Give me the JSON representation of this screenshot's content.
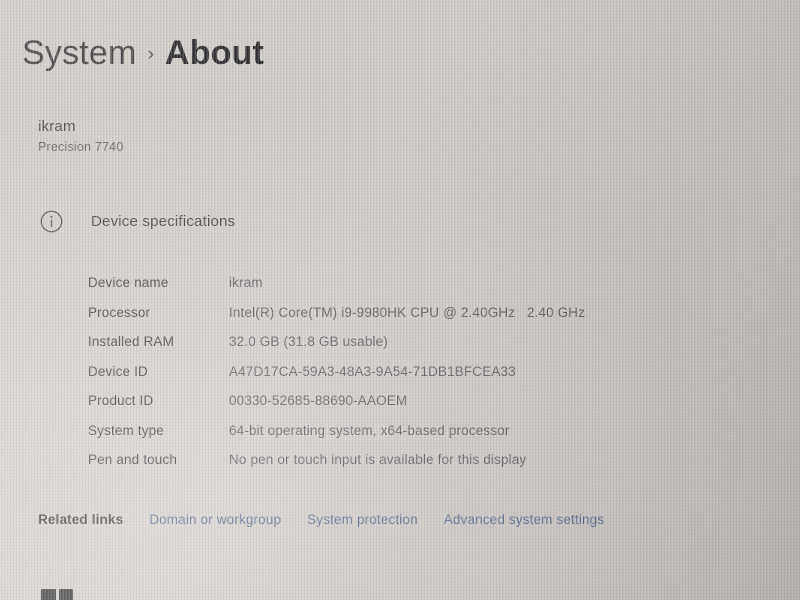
{
  "breadcrumb": {
    "root": "System",
    "separator": "›",
    "current": "About"
  },
  "device_heading": {
    "name": "ikram",
    "model": "Precision 7740"
  },
  "spec_section": {
    "icon": "info-icon",
    "title": "Device specifications",
    "rows": [
      {
        "label": "Device name",
        "value": "ikram"
      },
      {
        "label": "Processor",
        "value": "Intel(R) Core(TM) i9-9980HK CPU @ 2.40GHz   2.40 GHz"
      },
      {
        "label": "Installed RAM",
        "value": "32.0 GB (31.8 GB usable)"
      },
      {
        "label": "Device ID",
        "value": "A47D17CA-59A3-48A3-9A54-71DB1BFCEA33"
      },
      {
        "label": "Product ID",
        "value": "00330-52685-88690-AAOEM"
      },
      {
        "label": "System type",
        "value": "64-bit operating system, x64-based processor"
      },
      {
        "label": "Pen and touch",
        "value": "No pen or touch input is available for this display"
      }
    ]
  },
  "related_links": {
    "title": "Related links",
    "links": [
      "Domain or workgroup",
      "System protection",
      "Advanced system settings"
    ]
  },
  "colors": {
    "background": "#cdc8c4",
    "label_text": "#353436",
    "value_text": "#56545a",
    "link_text": "#4a5f86",
    "heading_text": "#222124"
  }
}
